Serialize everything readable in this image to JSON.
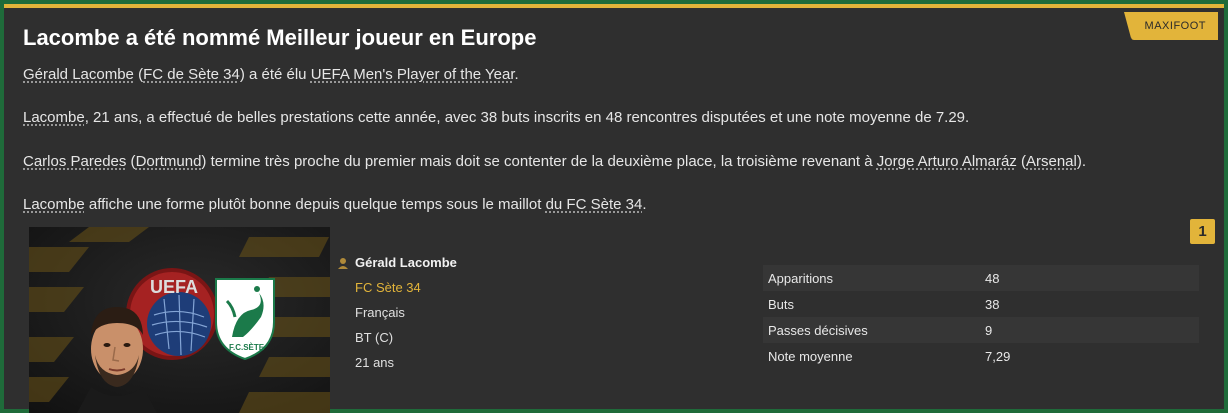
{
  "badge": "MAXIFOOT",
  "title": "Lacombe a été nommé Meilleur joueur en Europe",
  "p1": {
    "player": "Gérald Lacombe",
    "club_open": "(",
    "club": "FC de Sète 34",
    "club_close": ")",
    "mid": " a été élu ",
    "award": "UEFA Men's Player of the Year",
    "end": "."
  },
  "p2": {
    "player": "Lacombe",
    "rest": ", 21 ans, a effectué de belles prestations cette année, avec 38 buts inscrits en 48 rencontres disputées et une note moyenne de 7.29."
  },
  "p3": {
    "second": "Carlos Paredes",
    "second_club": "Dortmund",
    "mid": " termine très proche du premier mais doit se contenter de la deuxième place, la troisième revenant à ",
    "third": "Jorge Arturo Almaráz",
    "third_club": "Arsenal"
  },
  "p4": {
    "player": "Lacombe",
    "mid": " affiche une forme plutôt bonne depuis quelque temps sous le maillot ",
    "club": "du FC Sète 34",
    "end": "."
  },
  "rank": "1",
  "image": {
    "uefa_text": "UEFA",
    "club_crest_text": "F.C.SÈTE"
  },
  "player_card": {
    "name": "Gérald Lacombe",
    "club": "FC Sète 34",
    "nationality": "Français",
    "position": "BT (C)",
    "age": "21 ans"
  },
  "stats": [
    {
      "label": "Apparitions",
      "value": "48"
    },
    {
      "label": "Buts",
      "value": "38"
    },
    {
      "label": "Passes décisives",
      "value": "9"
    },
    {
      "label": "Note moyenne",
      "value": "7,29"
    }
  ],
  "colors": {
    "accent": "#e2b43a",
    "panel": "#2f2f2f",
    "outer": "#1f6b3a"
  },
  "icons": [
    "person-icon",
    "uefa-logo",
    "club-crest-icon"
  ]
}
